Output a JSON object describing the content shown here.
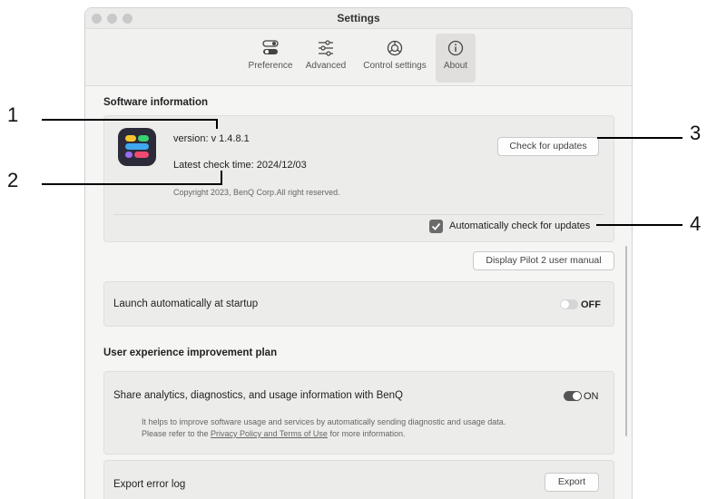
{
  "window": {
    "title": "Settings"
  },
  "tabs": [
    {
      "label": "Preference",
      "icon": "toggle-icon"
    },
    {
      "label": "Advanced",
      "icon": "sliders-icon"
    },
    {
      "label": "Control settings",
      "icon": "control-icon"
    },
    {
      "label": "About",
      "icon": "info-icon"
    }
  ],
  "software": {
    "section_title": "Software information",
    "version": "version: v 1.4.8.1",
    "check_time": "Latest check time: 2024/12/03",
    "copyright": "Copyright  2023, BenQ Corp.All right reserved.",
    "check_updates_button": "Check for updates",
    "auto_check_label": "Automatically check for updates",
    "auto_check_checked": true
  },
  "manual_button": "Display Pilot 2 user manual",
  "launch": {
    "label": "Launch automatically at startup",
    "state": "OFF"
  },
  "ux": {
    "section_title": "User experience improvement plan",
    "share_label": "Share analytics, diagnostics, and usage information with BenQ",
    "share_state": "ON",
    "desc1": "It helps to improve software usage and services by automatically sending diagnostic and usage data.",
    "desc2_prefix": "Please refer to the ",
    "desc2_link": "Privacy Policy and Terms of Use",
    "desc2_suffix": " for more information."
  },
  "export": {
    "label": "Export error log",
    "button": "Export"
  },
  "callouts": [
    "1",
    "2",
    "3",
    "4"
  ],
  "colors": {
    "toggle_on": "#555555",
    "toggle_off": "#d5d5d5",
    "checkbox": "#6b6b6b"
  }
}
